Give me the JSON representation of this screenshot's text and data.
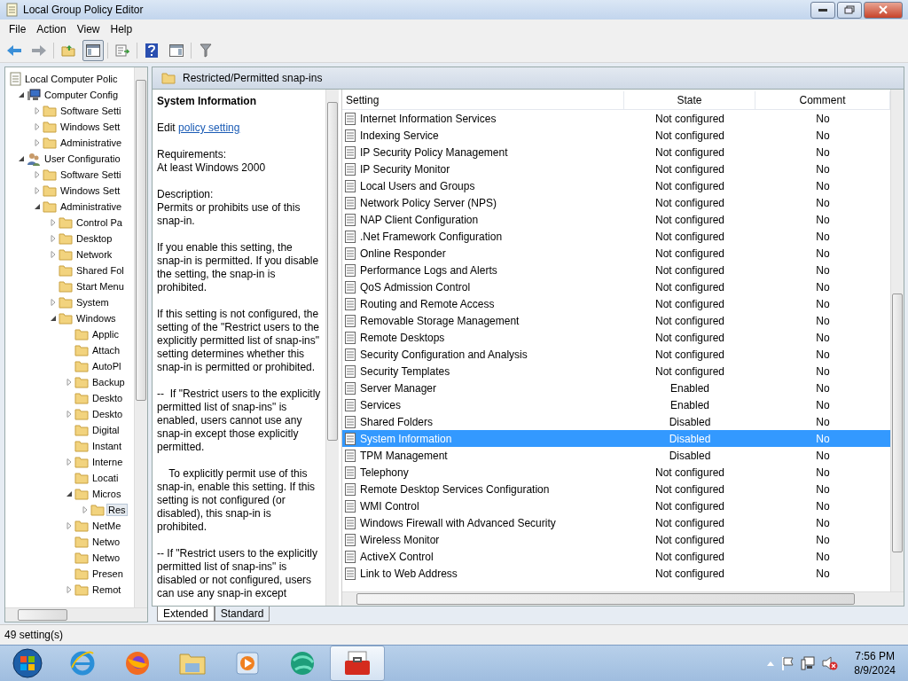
{
  "window": {
    "title": "Local Group Policy Editor"
  },
  "menu": [
    "File",
    "Action",
    "View",
    "Help"
  ],
  "toolbar": {
    "tree_toggle_pressed": true
  },
  "tree": [
    {
      "label": "Local Computer Polic",
      "kind": "policy",
      "selected": false,
      "children": [
        {
          "label": "Computer Config",
          "kind": "computer",
          "expandable": true,
          "expanded": true,
          "selected": false,
          "children": [
            {
              "label": "Software Setti",
              "kind": "folder",
              "expandable": true,
              "expanded": false,
              "selected": false
            },
            {
              "label": "Windows Sett",
              "kind": "folder",
              "expandable": true,
              "expanded": false,
              "selected": false
            },
            {
              "label": "Administrative",
              "kind": "folder",
              "expandable": true,
              "expanded": false,
              "selected": false
            }
          ]
        },
        {
          "label": "User Configuratio",
          "kind": "user",
          "expandable": true,
          "expanded": true,
          "selected": false,
          "children": [
            {
              "label": "Software Setti",
              "kind": "folder",
              "expandable": true,
              "expanded": false,
              "selected": false
            },
            {
              "label": "Windows Sett",
              "kind": "folder",
              "expandable": true,
              "expanded": false,
              "selected": false
            },
            {
              "label": "Administrative",
              "kind": "folder",
              "expandable": true,
              "expanded": true,
              "selected": false,
              "children": [
                {
                  "label": "Control Pa",
                  "kind": "folder",
                  "expandable": true,
                  "expanded": false,
                  "selected": false
                },
                {
                  "label": "Desktop",
                  "kind": "folder",
                  "expandable": true,
                  "expanded": false,
                  "selected": false
                },
                {
                  "label": "Network",
                  "kind": "folder",
                  "expandable": true,
                  "expanded": false,
                  "selected": false
                },
                {
                  "label": "Shared Fol",
                  "kind": "folder",
                  "expandable": false,
                  "selected": false
                },
                {
                  "label": "Start Menu",
                  "kind": "folder",
                  "expandable": false,
                  "selected": false
                },
                {
                  "label": "System",
                  "kind": "folder",
                  "expandable": true,
                  "expanded": false,
                  "selected": false
                },
                {
                  "label": "Windows",
                  "kind": "folder",
                  "expandable": true,
                  "expanded": true,
                  "selected": false,
                  "children": [
                    {
                      "label": "Applic",
                      "kind": "folder",
                      "expandable": false,
                      "selected": false
                    },
                    {
                      "label": "Attach",
                      "kind": "folder",
                      "expandable": false,
                      "selected": false
                    },
                    {
                      "label": "AutoPl",
                      "kind": "folder",
                      "expandable": false,
                      "selected": false
                    },
                    {
                      "label": "Backup",
                      "kind": "folder",
                      "expandable": true,
                      "expanded": false,
                      "selected": false
                    },
                    {
                      "label": "Deskto",
                      "kind": "folder",
                      "expandable": false,
                      "selected": false
                    },
                    {
                      "label": "Deskto",
                      "kind": "folder",
                      "expandable": true,
                      "expanded": false,
                      "selected": false
                    },
                    {
                      "label": "Digital",
                      "kind": "folder",
                      "expandable": false,
                      "selected": false
                    },
                    {
                      "label": "Instant",
                      "kind": "folder",
                      "expandable": false,
                      "selected": false
                    },
                    {
                      "label": "Interne",
                      "kind": "folder",
                      "expandable": true,
                      "expanded": false,
                      "selected": false
                    },
                    {
                      "label": "Locati",
                      "kind": "folder",
                      "expandable": false,
                      "selected": false
                    },
                    {
                      "label": "Micros",
                      "kind": "folder",
                      "expandable": true,
                      "expanded": true,
                      "selected": false,
                      "children": [
                        {
                          "label": "Res",
                          "kind": "folder",
                          "expandable": true,
                          "expanded": false,
                          "selected": true
                        }
                      ]
                    },
                    {
                      "label": "NetMe",
                      "kind": "folder",
                      "expandable": true,
                      "expanded": false,
                      "selected": false
                    },
                    {
                      "label": "Netwo",
                      "kind": "folder",
                      "expandable": false,
                      "selected": false
                    },
                    {
                      "label": "Netwo",
                      "kind": "folder",
                      "expandable": false,
                      "selected": false
                    },
                    {
                      "label": "Presen",
                      "kind": "folder",
                      "expandable": false,
                      "selected": false
                    },
                    {
                      "label": "Remot",
                      "kind": "folder",
                      "expandable": true,
                      "expanded": false,
                      "selected": false
                    }
                  ]
                }
              ]
            }
          ]
        }
      ]
    }
  ],
  "pane_title": "Restricted/Permitted snap-ins",
  "description": {
    "title": "System Information",
    "edit_prefix": "Edit",
    "edit_link": "policy setting",
    "paragraphs": [
      "Requirements:\nAt least Windows 2000",
      "Description:\nPermits or prohibits use of this snap-in.",
      "If you enable this setting, the snap-in is permitted. If you disable the setting, the snap-in is prohibited.",
      "If this setting is not configured, the setting of the \"Restrict users to the explicitly permitted list of snap-ins\" setting determines whether this snap-in is permitted or prohibited.",
      "--  If \"Restrict users to the explicitly permitted list of snap-ins\" is enabled, users cannot use any snap-in except those explicitly permitted.",
      "    To explicitly permit use of this snap-in, enable this setting. If this setting is not configured (or disabled), this snap-in is prohibited.",
      "-- If \"Restrict users to the explicitly permitted list of snap-ins\" is disabled or not configured, users can use any snap-in except"
    ]
  },
  "table": {
    "columns": [
      "Setting",
      "State",
      "Comment"
    ],
    "rows": [
      {
        "setting": "Internet Information Services",
        "state": "Not configured",
        "comment": "No",
        "selected": false
      },
      {
        "setting": "Indexing Service",
        "state": "Not configured",
        "comment": "No",
        "selected": false
      },
      {
        "setting": "IP Security Policy Management",
        "state": "Not configured",
        "comment": "No",
        "selected": false
      },
      {
        "setting": "IP Security Monitor",
        "state": "Not configured",
        "comment": "No",
        "selected": false
      },
      {
        "setting": "Local Users and Groups",
        "state": "Not configured",
        "comment": "No",
        "selected": false
      },
      {
        "setting": "Network Policy Server (NPS)",
        "state": "Not configured",
        "comment": "No",
        "selected": false
      },
      {
        "setting": "NAP Client Configuration",
        "state": "Not configured",
        "comment": "No",
        "selected": false
      },
      {
        "setting": ".Net Framework Configuration",
        "state": "Not configured",
        "comment": "No",
        "selected": false
      },
      {
        "setting": "Online Responder",
        "state": "Not configured",
        "comment": "No",
        "selected": false
      },
      {
        "setting": "Performance Logs and Alerts",
        "state": "Not configured",
        "comment": "No",
        "selected": false
      },
      {
        "setting": "QoS Admission Control",
        "state": "Not configured",
        "comment": "No",
        "selected": false
      },
      {
        "setting": "Routing and Remote Access",
        "state": "Not configured",
        "comment": "No",
        "selected": false
      },
      {
        "setting": "Removable Storage Management",
        "state": "Not configured",
        "comment": "No",
        "selected": false
      },
      {
        "setting": "Remote Desktops",
        "state": "Not configured",
        "comment": "No",
        "selected": false
      },
      {
        "setting": "Security Configuration and Analysis",
        "state": "Not configured",
        "comment": "No",
        "selected": false
      },
      {
        "setting": "Security Templates",
        "state": "Not configured",
        "comment": "No",
        "selected": false
      },
      {
        "setting": "Server Manager",
        "state": "Enabled",
        "comment": "No",
        "selected": false
      },
      {
        "setting": "Services",
        "state": "Enabled",
        "comment": "No",
        "selected": false
      },
      {
        "setting": "Shared Folders",
        "state": "Disabled",
        "comment": "No",
        "selected": false
      },
      {
        "setting": "System Information",
        "state": "Disabled",
        "comment": "No",
        "selected": true
      },
      {
        "setting": "TPM Management",
        "state": "Disabled",
        "comment": "No",
        "selected": false
      },
      {
        "setting": "Telephony",
        "state": "Not configured",
        "comment": "No",
        "selected": false
      },
      {
        "setting": "Remote Desktop Services Configuration",
        "state": "Not configured",
        "comment": "No",
        "selected": false
      },
      {
        "setting": "WMI Control",
        "state": "Not configured",
        "comment": "No",
        "selected": false
      },
      {
        "setting": "Windows Firewall with Advanced Security",
        "state": "Not configured",
        "comment": "No",
        "selected": false
      },
      {
        "setting": "Wireless Monitor",
        "state": "Not configured",
        "comment": "No",
        "selected": false
      },
      {
        "setting": "ActiveX Control",
        "state": "Not configured",
        "comment": "No",
        "selected": false
      },
      {
        "setting": "Link to Web Address",
        "state": "Not configured",
        "comment": "No",
        "selected": false
      }
    ]
  },
  "view_tabs": [
    {
      "label": "Extended",
      "selected": true
    },
    {
      "label": "Standard",
      "selected": false
    }
  ],
  "status_bar": "49 setting(s)",
  "taskbar": {
    "apps": [
      {
        "kind": "ie",
        "active": false
      },
      {
        "kind": "firefox",
        "active": false
      },
      {
        "kind": "explorer",
        "active": false
      },
      {
        "kind": "media",
        "active": false
      },
      {
        "kind": "globe",
        "active": false
      },
      {
        "kind": "toolbox",
        "active": true
      }
    ],
    "time": "7:56 PM",
    "date": "8/9/2024"
  }
}
